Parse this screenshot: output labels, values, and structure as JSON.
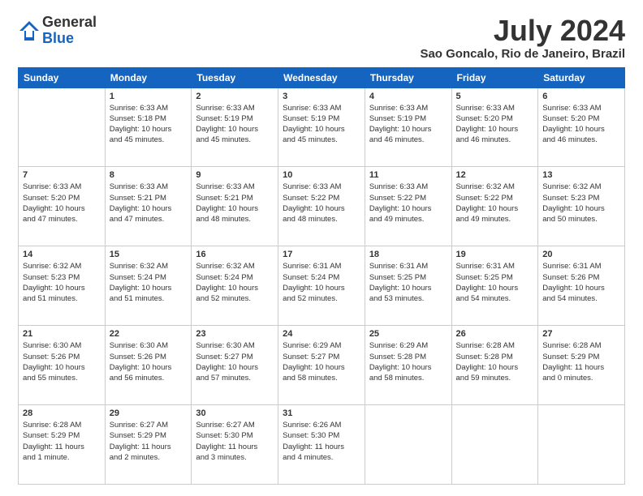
{
  "logo": {
    "general": "General",
    "blue": "Blue"
  },
  "title": "July 2024",
  "subtitle": "Sao Goncalo, Rio de Janeiro, Brazil",
  "columns": [
    "Sunday",
    "Monday",
    "Tuesday",
    "Wednesday",
    "Thursday",
    "Friday",
    "Saturday"
  ],
  "weeks": [
    [
      {
        "day": "",
        "info": ""
      },
      {
        "day": "1",
        "info": "Sunrise: 6:33 AM\nSunset: 5:18 PM\nDaylight: 10 hours\nand 45 minutes."
      },
      {
        "day": "2",
        "info": "Sunrise: 6:33 AM\nSunset: 5:19 PM\nDaylight: 10 hours\nand 45 minutes."
      },
      {
        "day": "3",
        "info": "Sunrise: 6:33 AM\nSunset: 5:19 PM\nDaylight: 10 hours\nand 45 minutes."
      },
      {
        "day": "4",
        "info": "Sunrise: 6:33 AM\nSunset: 5:19 PM\nDaylight: 10 hours\nand 46 minutes."
      },
      {
        "day": "5",
        "info": "Sunrise: 6:33 AM\nSunset: 5:20 PM\nDaylight: 10 hours\nand 46 minutes."
      },
      {
        "day": "6",
        "info": "Sunrise: 6:33 AM\nSunset: 5:20 PM\nDaylight: 10 hours\nand 46 minutes."
      }
    ],
    [
      {
        "day": "7",
        "info": "Sunrise: 6:33 AM\nSunset: 5:20 PM\nDaylight: 10 hours\nand 47 minutes."
      },
      {
        "day": "8",
        "info": "Sunrise: 6:33 AM\nSunset: 5:21 PM\nDaylight: 10 hours\nand 47 minutes."
      },
      {
        "day": "9",
        "info": "Sunrise: 6:33 AM\nSunset: 5:21 PM\nDaylight: 10 hours\nand 48 minutes."
      },
      {
        "day": "10",
        "info": "Sunrise: 6:33 AM\nSunset: 5:22 PM\nDaylight: 10 hours\nand 48 minutes."
      },
      {
        "day": "11",
        "info": "Sunrise: 6:33 AM\nSunset: 5:22 PM\nDaylight: 10 hours\nand 49 minutes."
      },
      {
        "day": "12",
        "info": "Sunrise: 6:32 AM\nSunset: 5:22 PM\nDaylight: 10 hours\nand 49 minutes."
      },
      {
        "day": "13",
        "info": "Sunrise: 6:32 AM\nSunset: 5:23 PM\nDaylight: 10 hours\nand 50 minutes."
      }
    ],
    [
      {
        "day": "14",
        "info": "Sunrise: 6:32 AM\nSunset: 5:23 PM\nDaylight: 10 hours\nand 51 minutes."
      },
      {
        "day": "15",
        "info": "Sunrise: 6:32 AM\nSunset: 5:24 PM\nDaylight: 10 hours\nand 51 minutes."
      },
      {
        "day": "16",
        "info": "Sunrise: 6:32 AM\nSunset: 5:24 PM\nDaylight: 10 hours\nand 52 minutes."
      },
      {
        "day": "17",
        "info": "Sunrise: 6:31 AM\nSunset: 5:24 PM\nDaylight: 10 hours\nand 52 minutes."
      },
      {
        "day": "18",
        "info": "Sunrise: 6:31 AM\nSunset: 5:25 PM\nDaylight: 10 hours\nand 53 minutes."
      },
      {
        "day": "19",
        "info": "Sunrise: 6:31 AM\nSunset: 5:25 PM\nDaylight: 10 hours\nand 54 minutes."
      },
      {
        "day": "20",
        "info": "Sunrise: 6:31 AM\nSunset: 5:26 PM\nDaylight: 10 hours\nand 54 minutes."
      }
    ],
    [
      {
        "day": "21",
        "info": "Sunrise: 6:30 AM\nSunset: 5:26 PM\nDaylight: 10 hours\nand 55 minutes."
      },
      {
        "day": "22",
        "info": "Sunrise: 6:30 AM\nSunset: 5:26 PM\nDaylight: 10 hours\nand 56 minutes."
      },
      {
        "day": "23",
        "info": "Sunrise: 6:30 AM\nSunset: 5:27 PM\nDaylight: 10 hours\nand 57 minutes."
      },
      {
        "day": "24",
        "info": "Sunrise: 6:29 AM\nSunset: 5:27 PM\nDaylight: 10 hours\nand 58 minutes."
      },
      {
        "day": "25",
        "info": "Sunrise: 6:29 AM\nSunset: 5:28 PM\nDaylight: 10 hours\nand 58 minutes."
      },
      {
        "day": "26",
        "info": "Sunrise: 6:28 AM\nSunset: 5:28 PM\nDaylight: 10 hours\nand 59 minutes."
      },
      {
        "day": "27",
        "info": "Sunrise: 6:28 AM\nSunset: 5:29 PM\nDaylight: 11 hours\nand 0 minutes."
      }
    ],
    [
      {
        "day": "28",
        "info": "Sunrise: 6:28 AM\nSunset: 5:29 PM\nDaylight: 11 hours\nand 1 minute."
      },
      {
        "day": "29",
        "info": "Sunrise: 6:27 AM\nSunset: 5:29 PM\nDaylight: 11 hours\nand 2 minutes."
      },
      {
        "day": "30",
        "info": "Sunrise: 6:27 AM\nSunset: 5:30 PM\nDaylight: 11 hours\nand 3 minutes."
      },
      {
        "day": "31",
        "info": "Sunrise: 6:26 AM\nSunset: 5:30 PM\nDaylight: 11 hours\nand 4 minutes."
      },
      {
        "day": "",
        "info": ""
      },
      {
        "day": "",
        "info": ""
      },
      {
        "day": "",
        "info": ""
      }
    ]
  ]
}
